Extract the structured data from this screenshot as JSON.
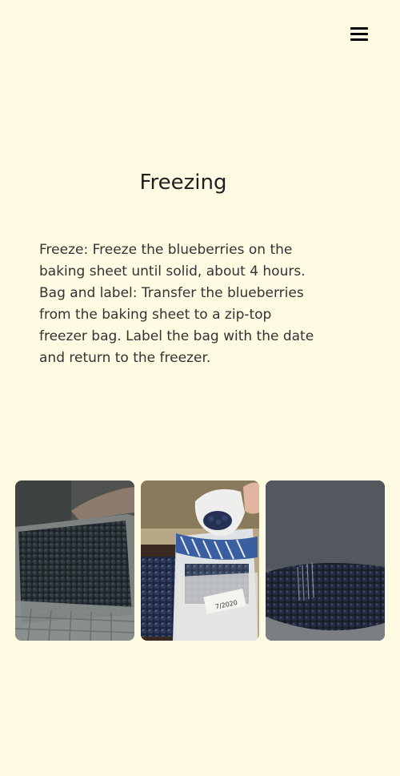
{
  "header": {
    "menu_icon": "hamburger-menu-icon"
  },
  "section": {
    "title": "Freezing",
    "body_lines": [
      "Freeze: Freeze the blueberries on the",
      "baking sheet until solid, about 4 hours.",
      "Bag and label: Transfer the blueberries",
      "from the baking sheet to a zip-top",
      "freezer bag. Label the bag with the date",
      "and return to the freezer."
    ]
  },
  "gallery": {
    "photos": [
      {
        "subject": "blueberries-on-baking-sheet"
      },
      {
        "subject": "pouring-blueberries-into-freezer-bag"
      },
      {
        "subject": "frozen-blueberries-in-bowl"
      }
    ]
  },
  "colors": {
    "background": "#fffbe2",
    "text": "#333333",
    "icon": "#000000"
  }
}
